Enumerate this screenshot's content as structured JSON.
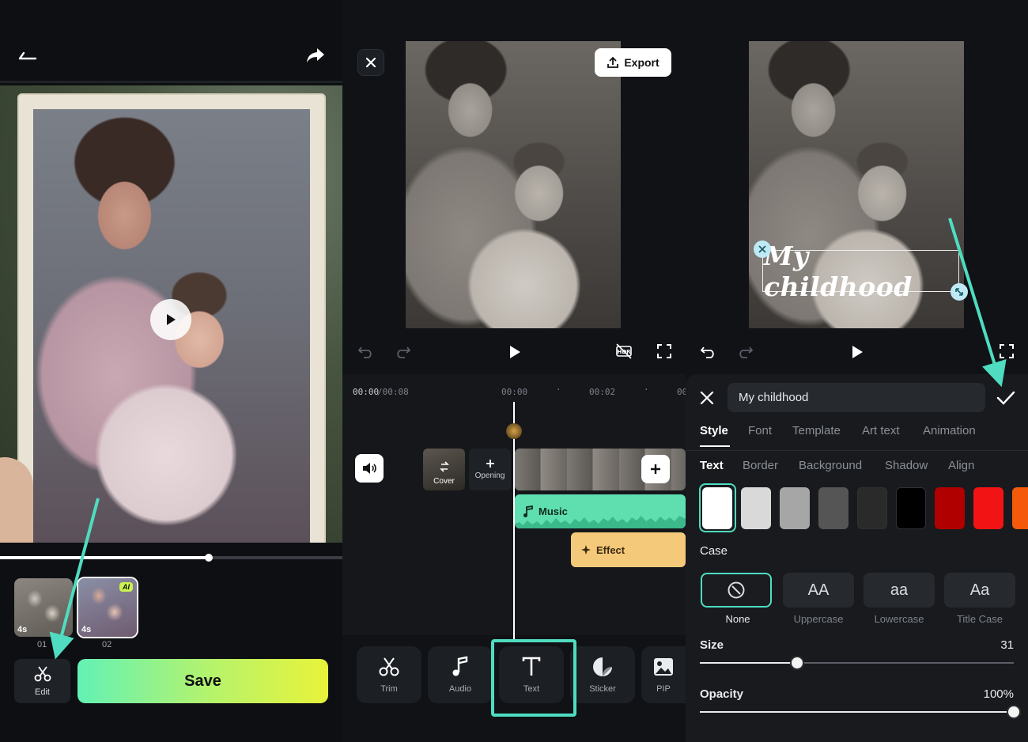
{
  "panel1": {
    "clips": [
      {
        "duration": "4s",
        "number": "01"
      },
      {
        "duration": "4s",
        "number": "02",
        "badge": "AI"
      }
    ],
    "edit_label": "Edit",
    "save_label": "Save",
    "playback_progress": 0.61
  },
  "panel2": {
    "export_label": "Export",
    "time_current": "00:00",
    "time_total": "/00:08",
    "ruler": [
      "00:00",
      "00:02",
      "00"
    ],
    "cover_label": "Cover",
    "opening_label": "Opening",
    "music_label": "Music",
    "effect_label": "Effect",
    "tools": [
      {
        "label": "Trim",
        "icon": "scissors-icon"
      },
      {
        "label": "Audio",
        "icon": "music-note-icon"
      },
      {
        "label": "Text",
        "icon": "text-t-icon"
      },
      {
        "label": "Sticker",
        "icon": "sticker-icon"
      },
      {
        "label": "PIP",
        "icon": "pip-image-icon"
      }
    ]
  },
  "panel3": {
    "overlay_text": "My childhood",
    "text_input_value": "My childhood",
    "tabs": [
      "Style",
      "Font",
      "Template",
      "Art text",
      "Animation"
    ],
    "subtabs": [
      "Text",
      "Border",
      "Background",
      "Shadow",
      "Align"
    ],
    "swatch_colors": [
      "#ffffff",
      "#d9d9d9",
      "#a6a6a6",
      "#555555",
      "#2a2a2a",
      "#000000",
      "#b00000",
      "#f21414",
      "#f55a0a"
    ],
    "case_title": "Case",
    "case_options": [
      {
        "display": "",
        "label": "None"
      },
      {
        "display": "AA",
        "label": "Uppercase"
      },
      {
        "display": "aa",
        "label": "Lowercase"
      },
      {
        "display": "Aa",
        "label": "Title Case"
      }
    ],
    "size_label": "Size",
    "size_value": "31",
    "size_fraction": 0.31,
    "opacity_label": "Opacity",
    "opacity_value": "100%",
    "opacity_fraction": 1.0
  },
  "colors": {
    "accent_teal": "#4fdcc0",
    "music_track": "#5fdfb0",
    "effect_track": "#f5c97a"
  }
}
